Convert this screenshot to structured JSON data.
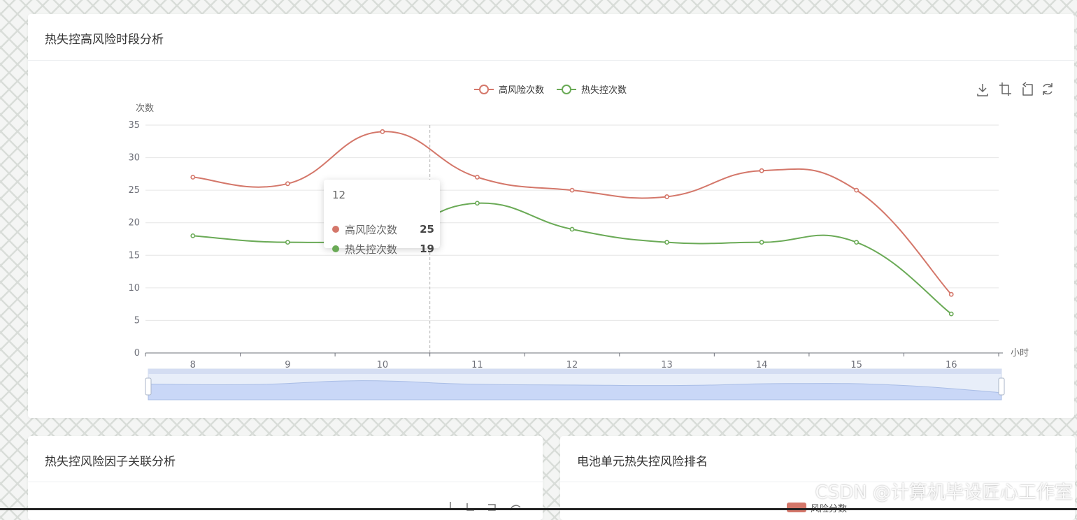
{
  "main_panel": {
    "title": "热失控高风险时段分析"
  },
  "panel_left": {
    "title": "热失控风险因子关联分析"
  },
  "panel_right": {
    "title": "电池单元热失控风险排名",
    "legend_partial": "风险分数"
  },
  "toolbox": [
    "download-icon",
    "zoom-icon",
    "zoom-reset-icon",
    "restore-icon"
  ],
  "watermark": "CSDN @计算机毕设匠心工作室",
  "tooltip": {
    "header": "12",
    "rows": [
      {
        "name": "高风险次数",
        "value": "25",
        "color": "#d4776a"
      },
      {
        "name": "热失控次数",
        "value": "19",
        "color": "#6aaa56"
      }
    ]
  },
  "chart_data": {
    "type": "line",
    "smooth": true,
    "x": [
      "8",
      "9",
      "10",
      "11",
      "12",
      "13",
      "14",
      "15",
      "16"
    ],
    "xlabel": "小时",
    "ylabel": "次数",
    "ylim": [
      0,
      35
    ],
    "yticks": [
      "0",
      "5",
      "10",
      "15",
      "20",
      "25",
      "30",
      "35"
    ],
    "grid": true,
    "legend_position": "top-center",
    "series": [
      {
        "name": "高风险次数",
        "color": "#d4776a",
        "values": [
          27,
          26,
          34,
          27,
          25,
          24,
          28,
          25,
          9
        ]
      },
      {
        "name": "热失控次数",
        "color": "#6aaa56",
        "values": [
          18,
          17,
          18,
          23,
          19,
          17,
          17,
          17,
          6
        ]
      }
    ],
    "datazoom": {
      "start_percent": 0,
      "end_percent": 100
    }
  }
}
